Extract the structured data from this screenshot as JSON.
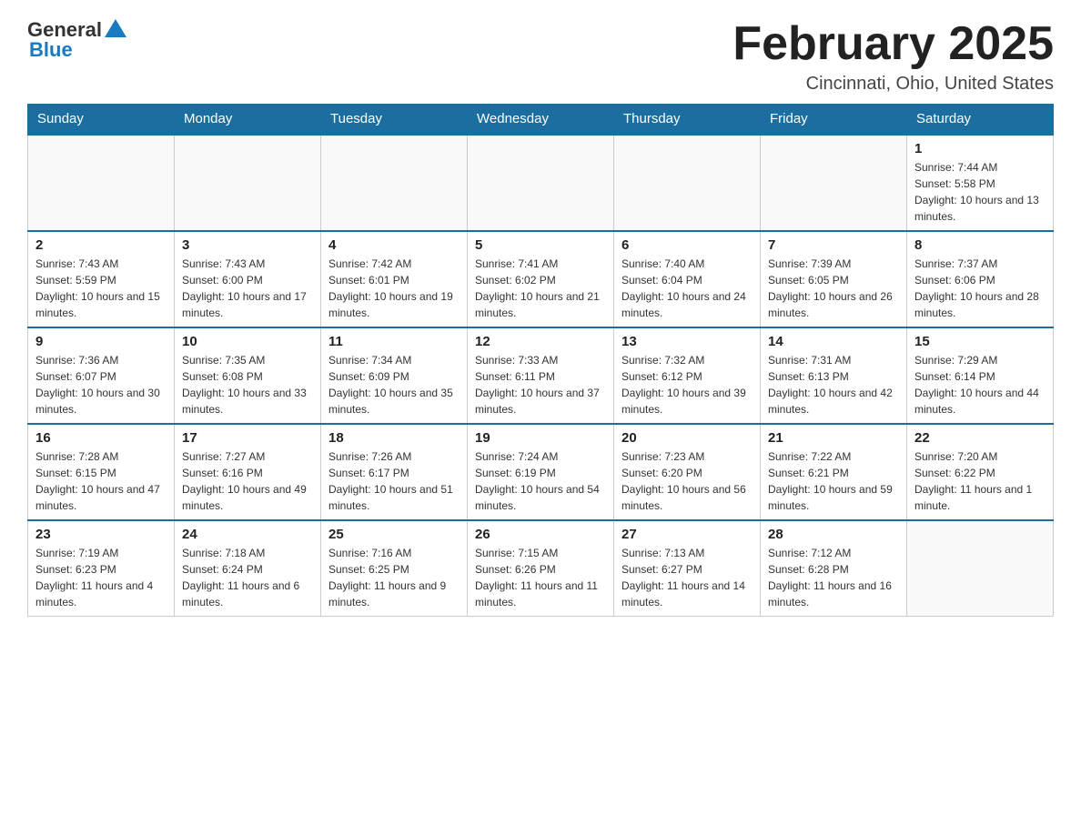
{
  "logo": {
    "general": "General",
    "blue": "Blue"
  },
  "title": "February 2025",
  "location": "Cincinnati, Ohio, United States",
  "days_of_week": [
    "Sunday",
    "Monday",
    "Tuesday",
    "Wednesday",
    "Thursday",
    "Friday",
    "Saturday"
  ],
  "weeks": [
    [
      {
        "day": "",
        "sunrise": "",
        "sunset": "",
        "daylight": "",
        "empty": true
      },
      {
        "day": "",
        "sunrise": "",
        "sunset": "",
        "daylight": "",
        "empty": true
      },
      {
        "day": "",
        "sunrise": "",
        "sunset": "",
        "daylight": "",
        "empty": true
      },
      {
        "day": "",
        "sunrise": "",
        "sunset": "",
        "daylight": "",
        "empty": true
      },
      {
        "day": "",
        "sunrise": "",
        "sunset": "",
        "daylight": "",
        "empty": true
      },
      {
        "day": "",
        "sunrise": "",
        "sunset": "",
        "daylight": "",
        "empty": true
      },
      {
        "day": "1",
        "sunrise": "Sunrise: 7:44 AM",
        "sunset": "Sunset: 5:58 PM",
        "daylight": "Daylight: 10 hours and 13 minutes.",
        "empty": false
      }
    ],
    [
      {
        "day": "2",
        "sunrise": "Sunrise: 7:43 AM",
        "sunset": "Sunset: 5:59 PM",
        "daylight": "Daylight: 10 hours and 15 minutes.",
        "empty": false
      },
      {
        "day": "3",
        "sunrise": "Sunrise: 7:43 AM",
        "sunset": "Sunset: 6:00 PM",
        "daylight": "Daylight: 10 hours and 17 minutes.",
        "empty": false
      },
      {
        "day": "4",
        "sunrise": "Sunrise: 7:42 AM",
        "sunset": "Sunset: 6:01 PM",
        "daylight": "Daylight: 10 hours and 19 minutes.",
        "empty": false
      },
      {
        "day": "5",
        "sunrise": "Sunrise: 7:41 AM",
        "sunset": "Sunset: 6:02 PM",
        "daylight": "Daylight: 10 hours and 21 minutes.",
        "empty": false
      },
      {
        "day": "6",
        "sunrise": "Sunrise: 7:40 AM",
        "sunset": "Sunset: 6:04 PM",
        "daylight": "Daylight: 10 hours and 24 minutes.",
        "empty": false
      },
      {
        "day": "7",
        "sunrise": "Sunrise: 7:39 AM",
        "sunset": "Sunset: 6:05 PM",
        "daylight": "Daylight: 10 hours and 26 minutes.",
        "empty": false
      },
      {
        "day": "8",
        "sunrise": "Sunrise: 7:37 AM",
        "sunset": "Sunset: 6:06 PM",
        "daylight": "Daylight: 10 hours and 28 minutes.",
        "empty": false
      }
    ],
    [
      {
        "day": "9",
        "sunrise": "Sunrise: 7:36 AM",
        "sunset": "Sunset: 6:07 PM",
        "daylight": "Daylight: 10 hours and 30 minutes.",
        "empty": false
      },
      {
        "day": "10",
        "sunrise": "Sunrise: 7:35 AM",
        "sunset": "Sunset: 6:08 PM",
        "daylight": "Daylight: 10 hours and 33 minutes.",
        "empty": false
      },
      {
        "day": "11",
        "sunrise": "Sunrise: 7:34 AM",
        "sunset": "Sunset: 6:09 PM",
        "daylight": "Daylight: 10 hours and 35 minutes.",
        "empty": false
      },
      {
        "day": "12",
        "sunrise": "Sunrise: 7:33 AM",
        "sunset": "Sunset: 6:11 PM",
        "daylight": "Daylight: 10 hours and 37 minutes.",
        "empty": false
      },
      {
        "day": "13",
        "sunrise": "Sunrise: 7:32 AM",
        "sunset": "Sunset: 6:12 PM",
        "daylight": "Daylight: 10 hours and 39 minutes.",
        "empty": false
      },
      {
        "day": "14",
        "sunrise": "Sunrise: 7:31 AM",
        "sunset": "Sunset: 6:13 PM",
        "daylight": "Daylight: 10 hours and 42 minutes.",
        "empty": false
      },
      {
        "day": "15",
        "sunrise": "Sunrise: 7:29 AM",
        "sunset": "Sunset: 6:14 PM",
        "daylight": "Daylight: 10 hours and 44 minutes.",
        "empty": false
      }
    ],
    [
      {
        "day": "16",
        "sunrise": "Sunrise: 7:28 AM",
        "sunset": "Sunset: 6:15 PM",
        "daylight": "Daylight: 10 hours and 47 minutes.",
        "empty": false
      },
      {
        "day": "17",
        "sunrise": "Sunrise: 7:27 AM",
        "sunset": "Sunset: 6:16 PM",
        "daylight": "Daylight: 10 hours and 49 minutes.",
        "empty": false
      },
      {
        "day": "18",
        "sunrise": "Sunrise: 7:26 AM",
        "sunset": "Sunset: 6:17 PM",
        "daylight": "Daylight: 10 hours and 51 minutes.",
        "empty": false
      },
      {
        "day": "19",
        "sunrise": "Sunrise: 7:24 AM",
        "sunset": "Sunset: 6:19 PM",
        "daylight": "Daylight: 10 hours and 54 minutes.",
        "empty": false
      },
      {
        "day": "20",
        "sunrise": "Sunrise: 7:23 AM",
        "sunset": "Sunset: 6:20 PM",
        "daylight": "Daylight: 10 hours and 56 minutes.",
        "empty": false
      },
      {
        "day": "21",
        "sunrise": "Sunrise: 7:22 AM",
        "sunset": "Sunset: 6:21 PM",
        "daylight": "Daylight: 10 hours and 59 minutes.",
        "empty": false
      },
      {
        "day": "22",
        "sunrise": "Sunrise: 7:20 AM",
        "sunset": "Sunset: 6:22 PM",
        "daylight": "Daylight: 11 hours and 1 minute.",
        "empty": false
      }
    ],
    [
      {
        "day": "23",
        "sunrise": "Sunrise: 7:19 AM",
        "sunset": "Sunset: 6:23 PM",
        "daylight": "Daylight: 11 hours and 4 minutes.",
        "empty": false
      },
      {
        "day": "24",
        "sunrise": "Sunrise: 7:18 AM",
        "sunset": "Sunset: 6:24 PM",
        "daylight": "Daylight: 11 hours and 6 minutes.",
        "empty": false
      },
      {
        "day": "25",
        "sunrise": "Sunrise: 7:16 AM",
        "sunset": "Sunset: 6:25 PM",
        "daylight": "Daylight: 11 hours and 9 minutes.",
        "empty": false
      },
      {
        "day": "26",
        "sunrise": "Sunrise: 7:15 AM",
        "sunset": "Sunset: 6:26 PM",
        "daylight": "Daylight: 11 hours and 11 minutes.",
        "empty": false
      },
      {
        "day": "27",
        "sunrise": "Sunrise: 7:13 AM",
        "sunset": "Sunset: 6:27 PM",
        "daylight": "Daylight: 11 hours and 14 minutes.",
        "empty": false
      },
      {
        "day": "28",
        "sunrise": "Sunrise: 7:12 AM",
        "sunset": "Sunset: 6:28 PM",
        "daylight": "Daylight: 11 hours and 16 minutes.",
        "empty": false
      },
      {
        "day": "",
        "sunrise": "",
        "sunset": "",
        "daylight": "",
        "empty": true
      }
    ]
  ]
}
